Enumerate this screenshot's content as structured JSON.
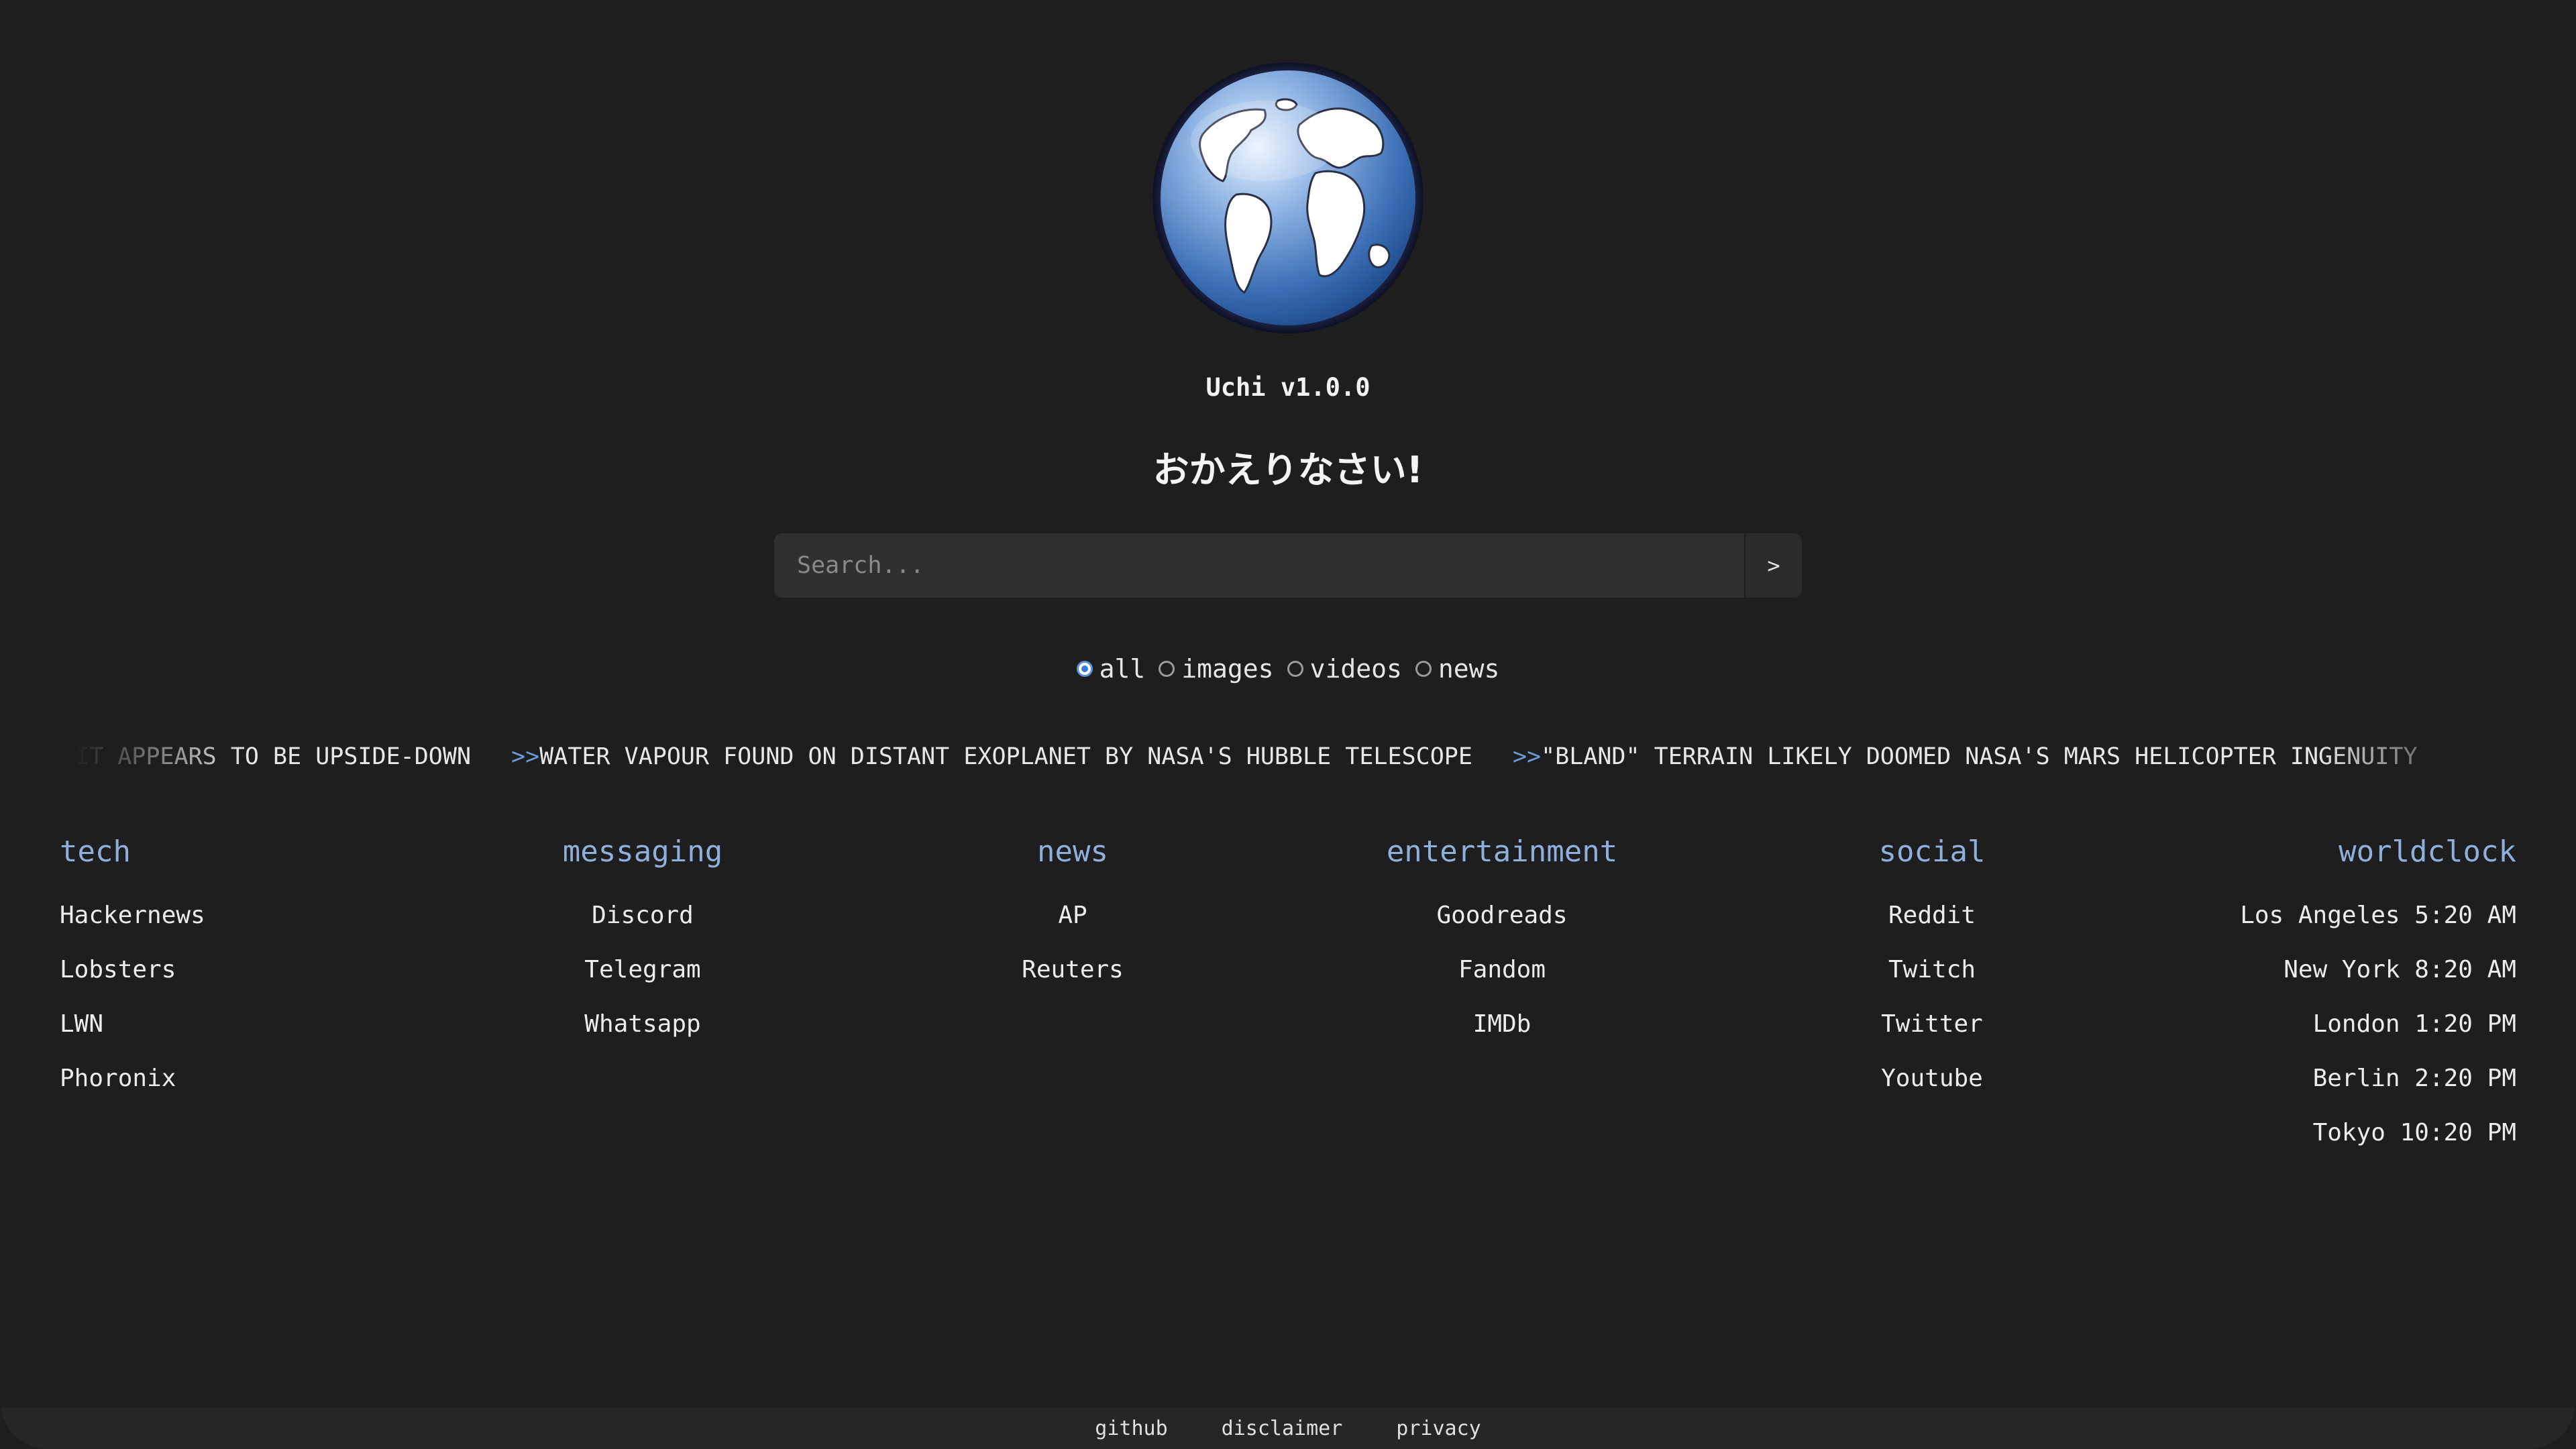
{
  "app": {
    "title": "Uchi v1.0.0",
    "welcome": "おかえりなさい!"
  },
  "search": {
    "placeholder": "Search...",
    "submit_label": ">"
  },
  "filters": [
    {
      "label": "all",
      "checked": true
    },
    {
      "label": "images",
      "checked": false
    },
    {
      "label": "videos",
      "checked": false
    },
    {
      "label": "news",
      "checked": false
    }
  ],
  "ticker": {
    "items": [
      {
        "prefix": "",
        "text": "IT APPEARS TO BE UPSIDE-DOWN"
      },
      {
        "prefix": ">>",
        "text": "WATER VAPOUR FOUND ON DISTANT EXOPLANET BY NASA'S HUBBLE TELESCOPE"
      },
      {
        "prefix": ">>",
        "text": "\"BLAND\" TERRAIN LIKELY DOOMED NASA'S MARS HELICOPTER INGENUITY"
      }
    ]
  },
  "columns": {
    "tech": {
      "title": "tech",
      "links": [
        "Hackernews",
        "Lobsters",
        "LWN",
        "Phoronix"
      ]
    },
    "messaging": {
      "title": "messaging",
      "links": [
        "Discord",
        "Telegram",
        "Whatsapp"
      ]
    },
    "news": {
      "title": "news",
      "links": [
        "AP",
        "Reuters"
      ]
    },
    "entertainment": {
      "title": "entertainment",
      "links": [
        "Goodreads",
        "Fandom",
        "IMDb"
      ]
    },
    "social": {
      "title": "social",
      "links": [
        "Reddit",
        "Twitch",
        "Twitter",
        "Youtube"
      ]
    },
    "worldclock": {
      "title": "worldclock",
      "entries": [
        "Los Angeles 5:20 AM",
        "New York 8:20 AM",
        "London 1:20 PM",
        "Berlin 2:20 PM",
        "Tokyo 10:20 PM"
      ]
    }
  },
  "footer": {
    "links": [
      "github",
      "disclaimer",
      "privacy"
    ]
  },
  "colors": {
    "background": "#1e1e1e",
    "accent": "#8fb0dc",
    "radio_checked": "#3a78d6"
  },
  "icons": {
    "logo": "globe-icon"
  }
}
